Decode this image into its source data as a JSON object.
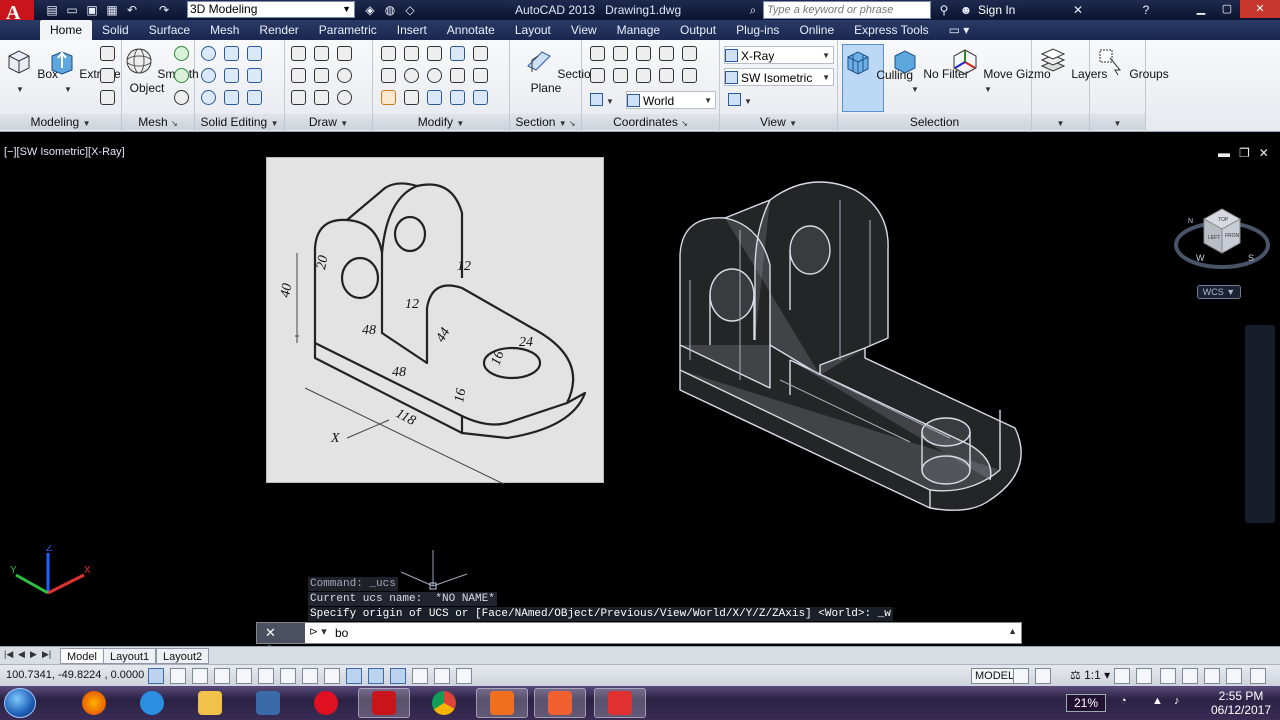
{
  "app": {
    "title": "AutoCAD 2013",
    "document": "Drawing1.dwg",
    "workspace": "3D Modeling",
    "search_placeholder": "Type a keyword or phrase",
    "sign_in": "Sign In",
    "quick_access_icons": [
      "new-icon",
      "open-icon",
      "save-icon",
      "print-icon",
      "undo-icon",
      "redo-icon"
    ]
  },
  "tabs": [
    "Home",
    "Solid",
    "Surface",
    "Mesh",
    "Render",
    "Parametric",
    "Insert",
    "Annotate",
    "Layout",
    "View",
    "Manage",
    "Output",
    "Plug-ins",
    "Online",
    "Express Tools"
  ],
  "active_tab": "Home",
  "ribbon": {
    "modeling": {
      "title": "Modeling",
      "box": "Box",
      "extrude": "Extrude"
    },
    "mesh": {
      "title": "Mesh",
      "smooth_line1": "Smooth",
      "smooth_line2": "Object"
    },
    "solid_editing": {
      "title": "Solid Editing"
    },
    "draw": {
      "title": "Draw"
    },
    "modify": {
      "title": "Modify"
    },
    "section": {
      "title": "Section",
      "plane_line1": "Section",
      "plane_line2": "Plane"
    },
    "coordinates": {
      "title": "Coordinates",
      "ucs": "World"
    },
    "view": {
      "title": "View",
      "visual_style": "X-Ray",
      "view_direction": "SW Isometric"
    },
    "selection": {
      "title": "Selection",
      "culling": "Culling",
      "no_filter": "No Filter",
      "move_gizmo": "Move Gizmo"
    },
    "layers": {
      "label": "Layers"
    },
    "groups": {
      "label": "Groups"
    }
  },
  "viewport": {
    "label": "[−][SW Isometric][X-Ray]",
    "viewcube": {
      "top": "TOP",
      "left": "LEFT",
      "front": "FRONT",
      "w": "W",
      "s": "S",
      "n": "N"
    },
    "wcs": "WCS"
  },
  "reference_drawing": {
    "dims": [
      "40",
      "20",
      "12",
      "12",
      "48",
      "44",
      "24",
      "16",
      "48",
      "16",
      "118",
      "X"
    ]
  },
  "command": {
    "history": [
      "Command: _ucs",
      "Current ucs name:  *NO NAME*",
      "Specify origin of UCS or [Face/NAmed/OBject/Previous/View/World/X/Y/Z/ZAxis] <World>: _w"
    ],
    "input": "bo"
  },
  "layout_tabs": [
    "Model",
    "Layout1",
    "Layout2"
  ],
  "status": {
    "coords": "100.7341, -49.8224 , 0.0000",
    "model": "MODEL",
    "scale": "1:1"
  },
  "taskbar": {
    "battery": "21%",
    "time": "2:55 PM",
    "date": "06/12/2017",
    "apps": [
      "firefox-icon",
      "ie-icon",
      "explorer-icon",
      "app-icon",
      "opera-icon",
      "autocad-icon",
      "chrome-icon",
      "camtasia-icon",
      "screenshot-icon",
      "kingsoft-icon"
    ]
  }
}
